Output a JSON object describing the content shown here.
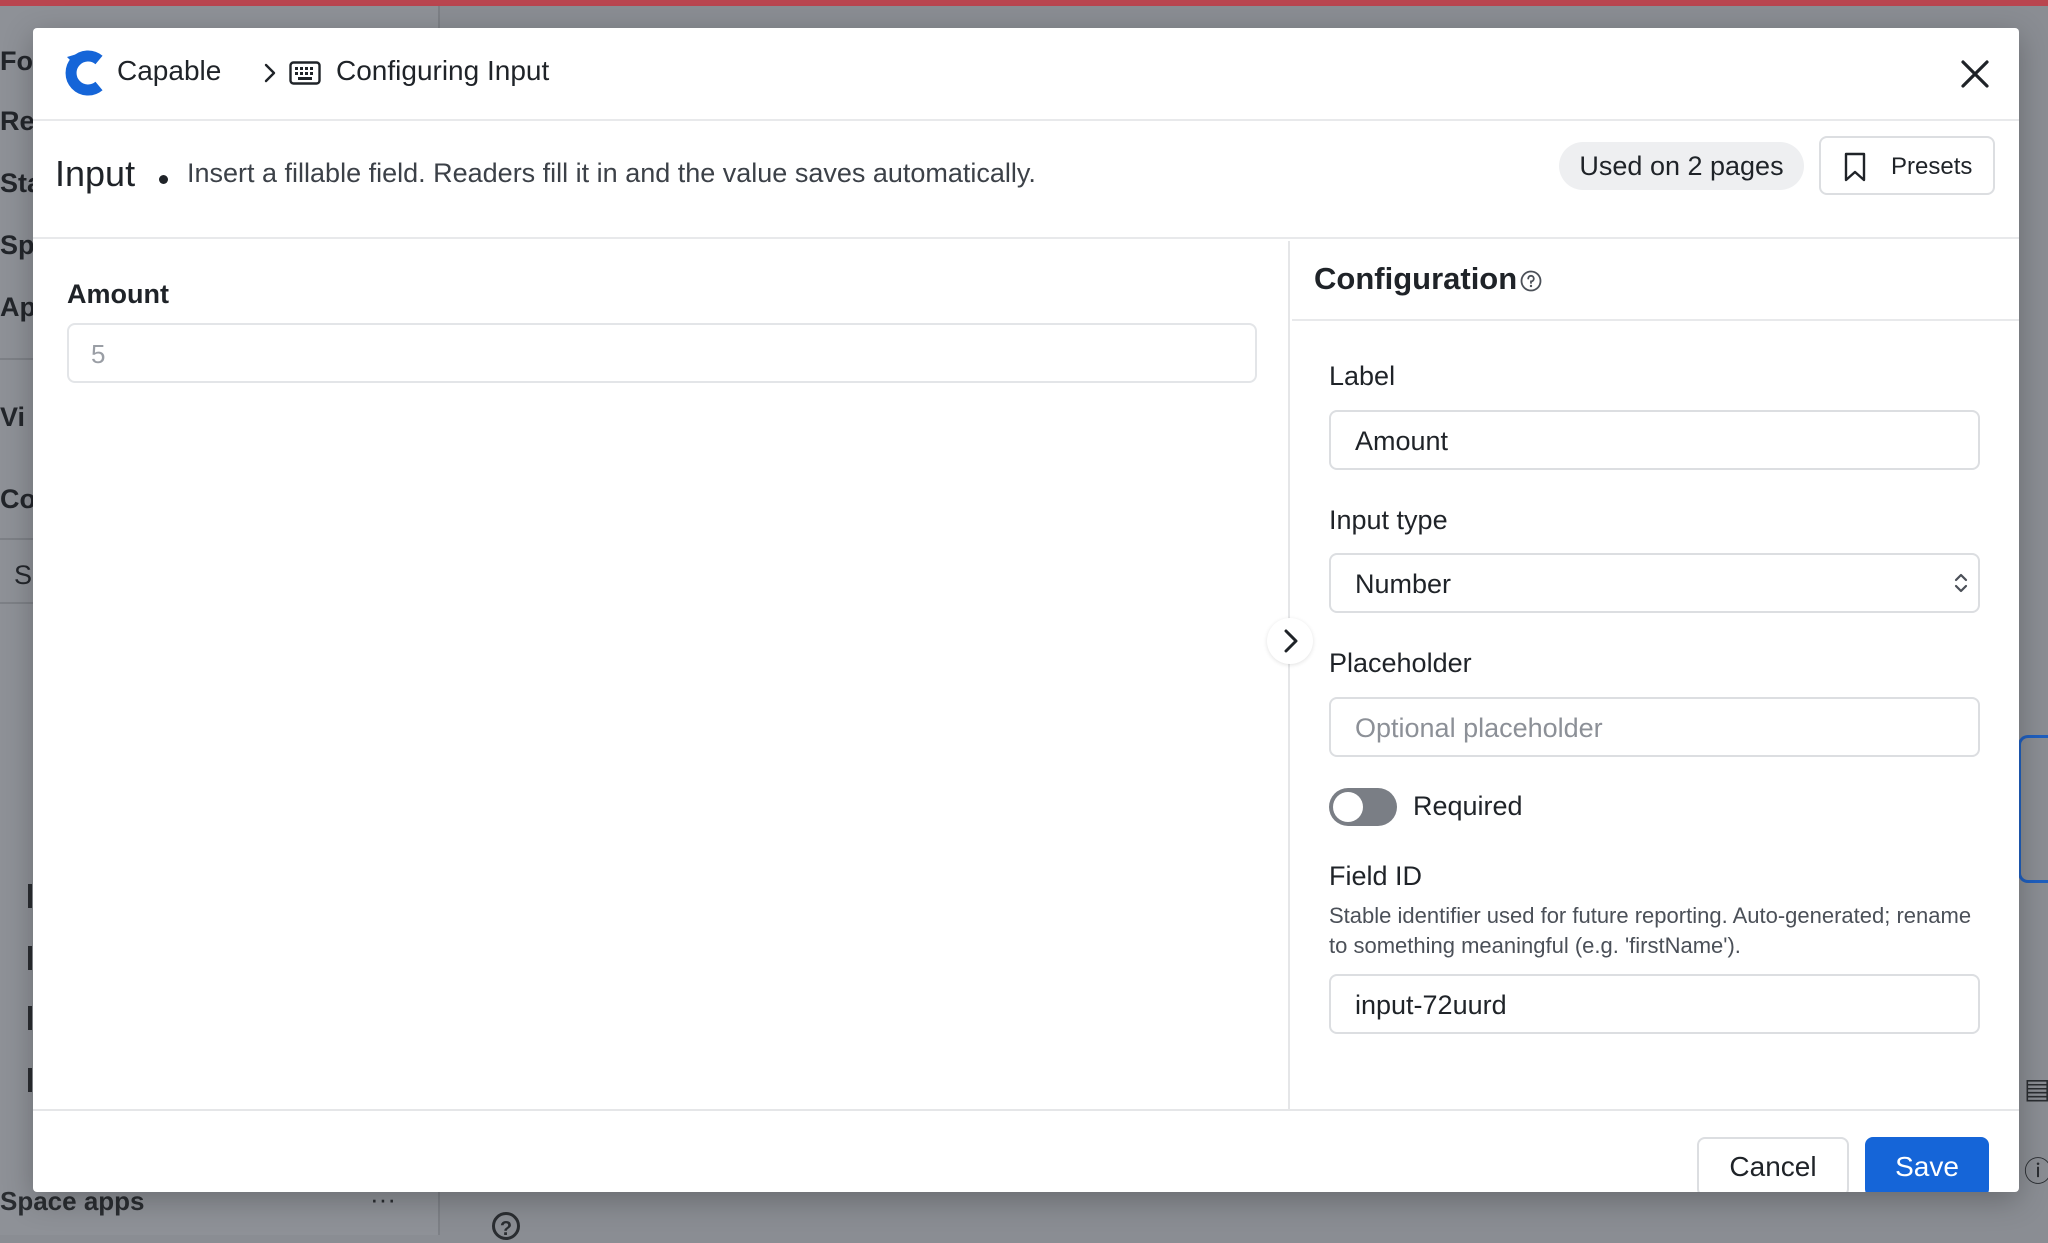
{
  "background": {
    "nav_items": [
      "Fo",
      "Re",
      "Sta",
      "Sp",
      "Ap",
      "Vi",
      "Co",
      "S"
    ],
    "apps_label": "Space apps",
    "dots": "···",
    "help_glyph": "?"
  },
  "header": {
    "app_name": "Capable",
    "page_title": "Configuring Input"
  },
  "subheader": {
    "title": "Input",
    "description": "Insert a fillable field. Readers fill it in and the value saves automatically.",
    "usage": "Used on 2 pages",
    "presets_label": "Presets"
  },
  "preview": {
    "label": "Amount",
    "placeholder": "5"
  },
  "config": {
    "title": "Configuration",
    "label_field": {
      "label": "Label",
      "value": "Amount"
    },
    "input_type_field": {
      "label": "Input type",
      "value": "Number"
    },
    "placeholder_field": {
      "label": "Placeholder",
      "placeholder": "Optional placeholder"
    },
    "required": {
      "label": "Required",
      "enabled": false
    },
    "field_id": {
      "label": "Field ID",
      "help": "Stable identifier used for future reporting. Auto-generated; rename to something meaningful (e.g. 'firstName').",
      "value": "input-72uurd"
    }
  },
  "footer": {
    "cancel_label": "Cancel",
    "save_label": "Save"
  },
  "colors": {
    "primary": "#1565d8",
    "toggle_off": "#7a7e85",
    "overlay": "#8a8d93",
    "top_bar": "#b9454f"
  }
}
